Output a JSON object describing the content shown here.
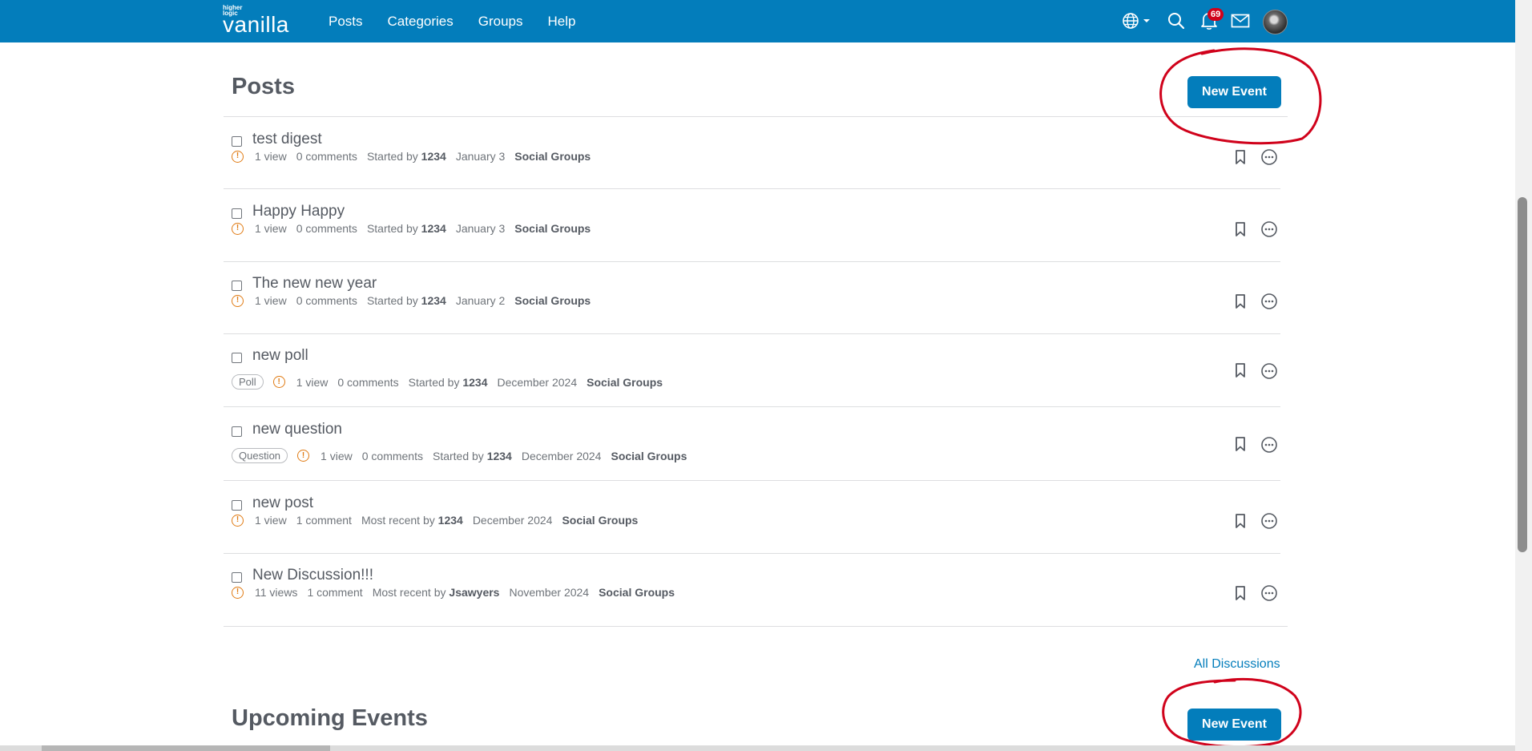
{
  "header": {
    "logo_small": "higher logic",
    "logo_main": "vanilla",
    "nav": [
      "Posts",
      "Categories",
      "Groups",
      "Help"
    ],
    "notification_count": "69",
    "icons": [
      "globe-icon",
      "search-icon",
      "bell-icon",
      "mail-icon",
      "avatar"
    ]
  },
  "posts_section": {
    "title": "Posts",
    "new_event_label": "New Event",
    "all_discussions_label": "All Discussions",
    "items": [
      {
        "title": "test digest",
        "tag": "",
        "views": "1 view",
        "comments": "0 comments",
        "started_label": "Started by",
        "author": "1234",
        "date": "January 3",
        "category": "Social Groups"
      },
      {
        "title": "Happy Happy",
        "tag": "",
        "views": "1 view",
        "comments": "0 comments",
        "started_label": "Started by",
        "author": "1234",
        "date": "January 3",
        "category": "Social Groups"
      },
      {
        "title": "The new new year",
        "tag": "",
        "views": "1 view",
        "comments": "0 comments",
        "started_label": "Started by",
        "author": "1234",
        "date": "January 2",
        "category": "Social Groups"
      },
      {
        "title": "new poll",
        "tag": "Poll",
        "views": "1 view",
        "comments": "0 comments",
        "started_label": "Started by",
        "author": "1234",
        "date": "December 2024",
        "category": "Social Groups"
      },
      {
        "title": "new question",
        "tag": "Question",
        "views": "1 view",
        "comments": "0 comments",
        "started_label": "Started by",
        "author": "1234",
        "date": "December 2024",
        "category": "Social Groups"
      },
      {
        "title": "new post",
        "tag": "",
        "views": "1 view",
        "comments": "1 comment",
        "started_label": "Most recent by",
        "author": "1234",
        "date": "December 2024",
        "category": "Social Groups"
      },
      {
        "title": "New Discussion!!!",
        "tag": "",
        "views": "11 views",
        "comments": "1 comment",
        "started_label": "Most recent by",
        "author": "Jsawyers",
        "date": "November 2024",
        "category": "Social Groups"
      }
    ]
  },
  "events_section": {
    "title": "Upcoming Events",
    "new_event_label": "New Event"
  },
  "colors": {
    "brand": "#037dbb",
    "warning": "#e07b14",
    "annotation": "#d0021b"
  }
}
